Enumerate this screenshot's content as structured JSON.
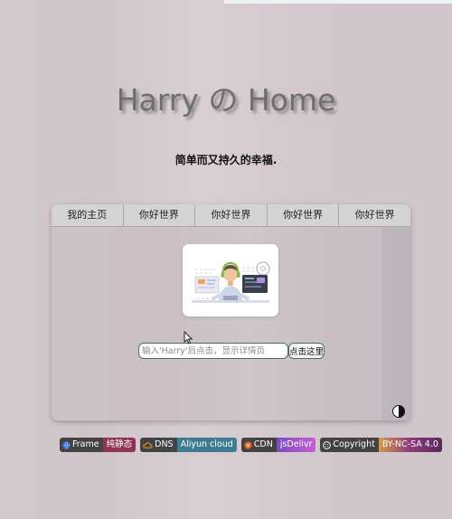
{
  "site": {
    "title": "Harry の Home",
    "subtitle": "简单而又持久的幸福."
  },
  "tabs": [
    {
      "label": "我的主页"
    },
    {
      "label": "你好世界"
    },
    {
      "label": "你好世界"
    },
    {
      "label": "你好世界"
    },
    {
      "label": "你好世界"
    }
  ],
  "search": {
    "placeholder": "输入'Harry'后点击，显示详情页",
    "value": "",
    "button_label": "点击这里"
  },
  "badges": [
    {
      "left": "Frame",
      "right": "纯静态",
      "icon": "globe-icon",
      "color": "#8e3553"
    },
    {
      "left": "DNS",
      "right": "Aliyun cloud",
      "icon": "cloud-icon",
      "color": "#3f7b91"
    },
    {
      "left": "CDN",
      "right": "jsDelivr",
      "icon": "cdn-icon",
      "color": "#9a52c9"
    },
    {
      "left": "Copyright",
      "right": "BY-NC-SA 4.0",
      "icon": "cc-icon",
      "color": "#c7884c"
    }
  ],
  "colors": {
    "title": "#6e6e6e",
    "tab_bar": "#d4d4d4",
    "badge_dark": "#434343"
  }
}
